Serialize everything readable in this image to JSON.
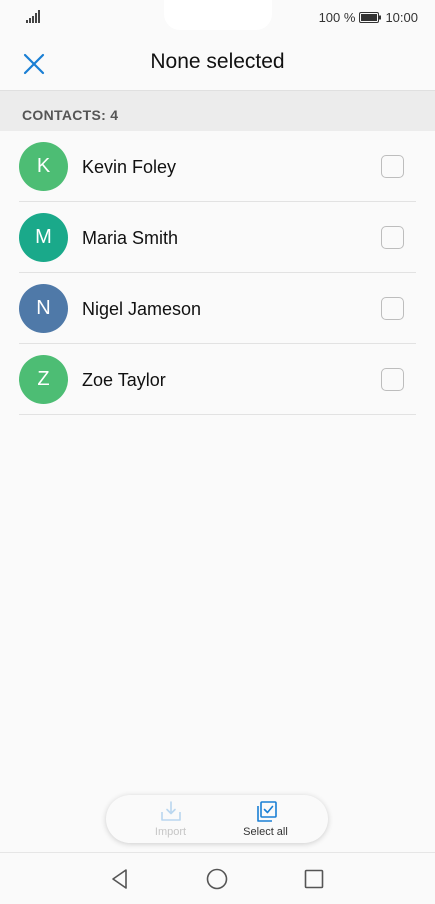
{
  "status_bar": {
    "battery_text": "100 %",
    "time": "10:00",
    "icons": [
      "signal-icon",
      "battery-icon"
    ]
  },
  "header": {
    "title": "None selected",
    "close_icon": "close-icon"
  },
  "section": {
    "label": "CONTACTS: 4"
  },
  "contacts": [
    {
      "initial": "K",
      "name": "Kevin Foley",
      "color": "#4dbd74",
      "checked": false
    },
    {
      "initial": "M",
      "name": "Maria Smith",
      "color": "#1aa98a",
      "checked": false
    },
    {
      "initial": "N",
      "name": "Nigel Jameson",
      "color": "#4f79a8",
      "checked": false
    },
    {
      "initial": "Z",
      "name": "Zoe Taylor",
      "color": "#4dbd74",
      "checked": false
    }
  ],
  "actions": {
    "import_label": "Import",
    "select_all_label": "Select all"
  },
  "colors": {
    "accent": "#1a7fd4",
    "disabled": "#b9d6ef"
  },
  "nav": {
    "icons": [
      "back-icon",
      "home-icon",
      "recents-icon"
    ]
  }
}
